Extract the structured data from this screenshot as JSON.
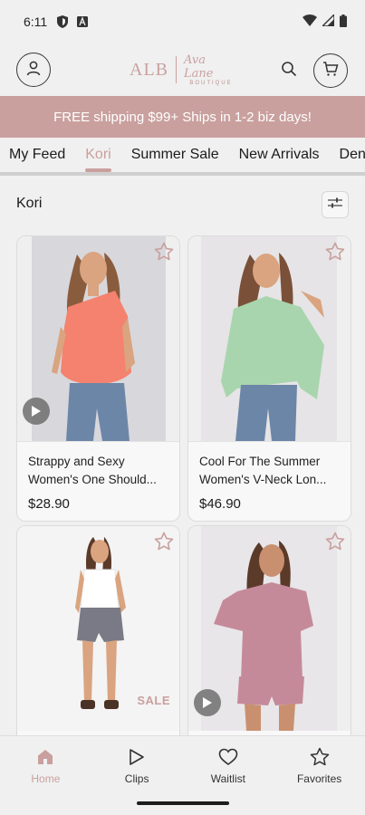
{
  "status_bar": {
    "time": "6:11"
  },
  "header": {
    "logo_mono": "ALB",
    "logo_name": "Ava Lane",
    "logo_sub": "BOUTIQUE"
  },
  "promo": {
    "text": "FREE shipping $99+ Ships in 1-2 biz days!"
  },
  "tabs": [
    {
      "label": "My Feed",
      "active": false
    },
    {
      "label": "Kori",
      "active": true
    },
    {
      "label": "Summer Sale",
      "active": false
    },
    {
      "label": "New Arrivals",
      "active": false
    },
    {
      "label": "Denim",
      "active": false
    }
  ],
  "section": {
    "title": "Kori"
  },
  "products": [
    {
      "title_line1": "Strappy and Sexy",
      "title_line2": "Women's One Should...",
      "price": "$28.90",
      "has_video": true,
      "sale_badge": "",
      "shirt_color": "#f4826e"
    },
    {
      "title_line1": "Cool For The Summer",
      "title_line2": "Women's V-Neck Lon...",
      "price": "$46.90",
      "has_video": false,
      "sale_badge": "",
      "shirt_color": "#a8d5ad"
    },
    {
      "title_line1": "",
      "title_line2": "",
      "price": "",
      "has_video": false,
      "sale_badge": "SALE",
      "shirt_color": "#ffffff"
    },
    {
      "title_line1": "",
      "title_line2": "",
      "price": "",
      "has_video": true,
      "sale_badge": "",
      "shirt_color": "#c58a9a"
    }
  ],
  "bottom_nav": [
    {
      "label": "Home",
      "icon": "home-icon",
      "active": true
    },
    {
      "label": "Clips",
      "icon": "play-icon",
      "active": false
    },
    {
      "label": "Waitlist",
      "icon": "heart-icon",
      "active": false
    },
    {
      "label": "Favorites",
      "icon": "star-icon",
      "active": false
    }
  ],
  "colors": {
    "accent": "#c9a09e",
    "background": "#f0f0f0"
  }
}
